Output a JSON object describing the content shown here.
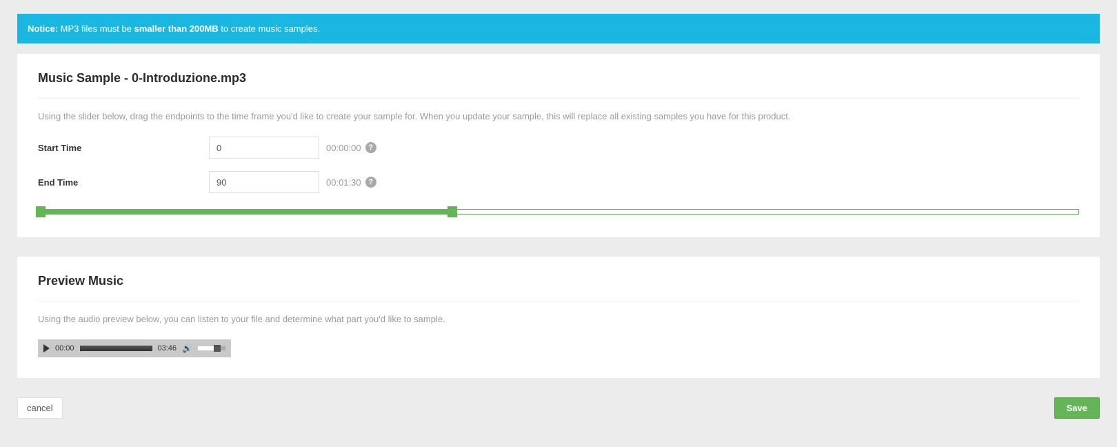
{
  "notice": {
    "label": "Notice:",
    "text_before": " MP3 files must be ",
    "bold_text": "smaller than 200MB",
    "text_after": " to create music samples."
  },
  "sample_panel": {
    "title": "Music Sample - 0-Introduzione.mp3",
    "description": "Using the slider below, drag the endpoints to the time frame you'd like to create your sample for. When you update your sample, this will replace all existing samples you have for this product.",
    "start_label": "Start Time",
    "start_value": "0",
    "start_display": "00:00:00",
    "end_label": "End Time",
    "end_value": "90",
    "end_display": "00:01:30",
    "slider": {
      "start_pct": 0,
      "end_pct": 39.8
    },
    "help_glyph": "?"
  },
  "preview_panel": {
    "title": "Preview Music",
    "description": "Using the audio preview below, you can listen to your file and determine what part you'd like to sample.",
    "current_time": "00:00",
    "duration": "03:46"
  },
  "actions": {
    "cancel_label": "cancel",
    "save_label": "Save"
  }
}
